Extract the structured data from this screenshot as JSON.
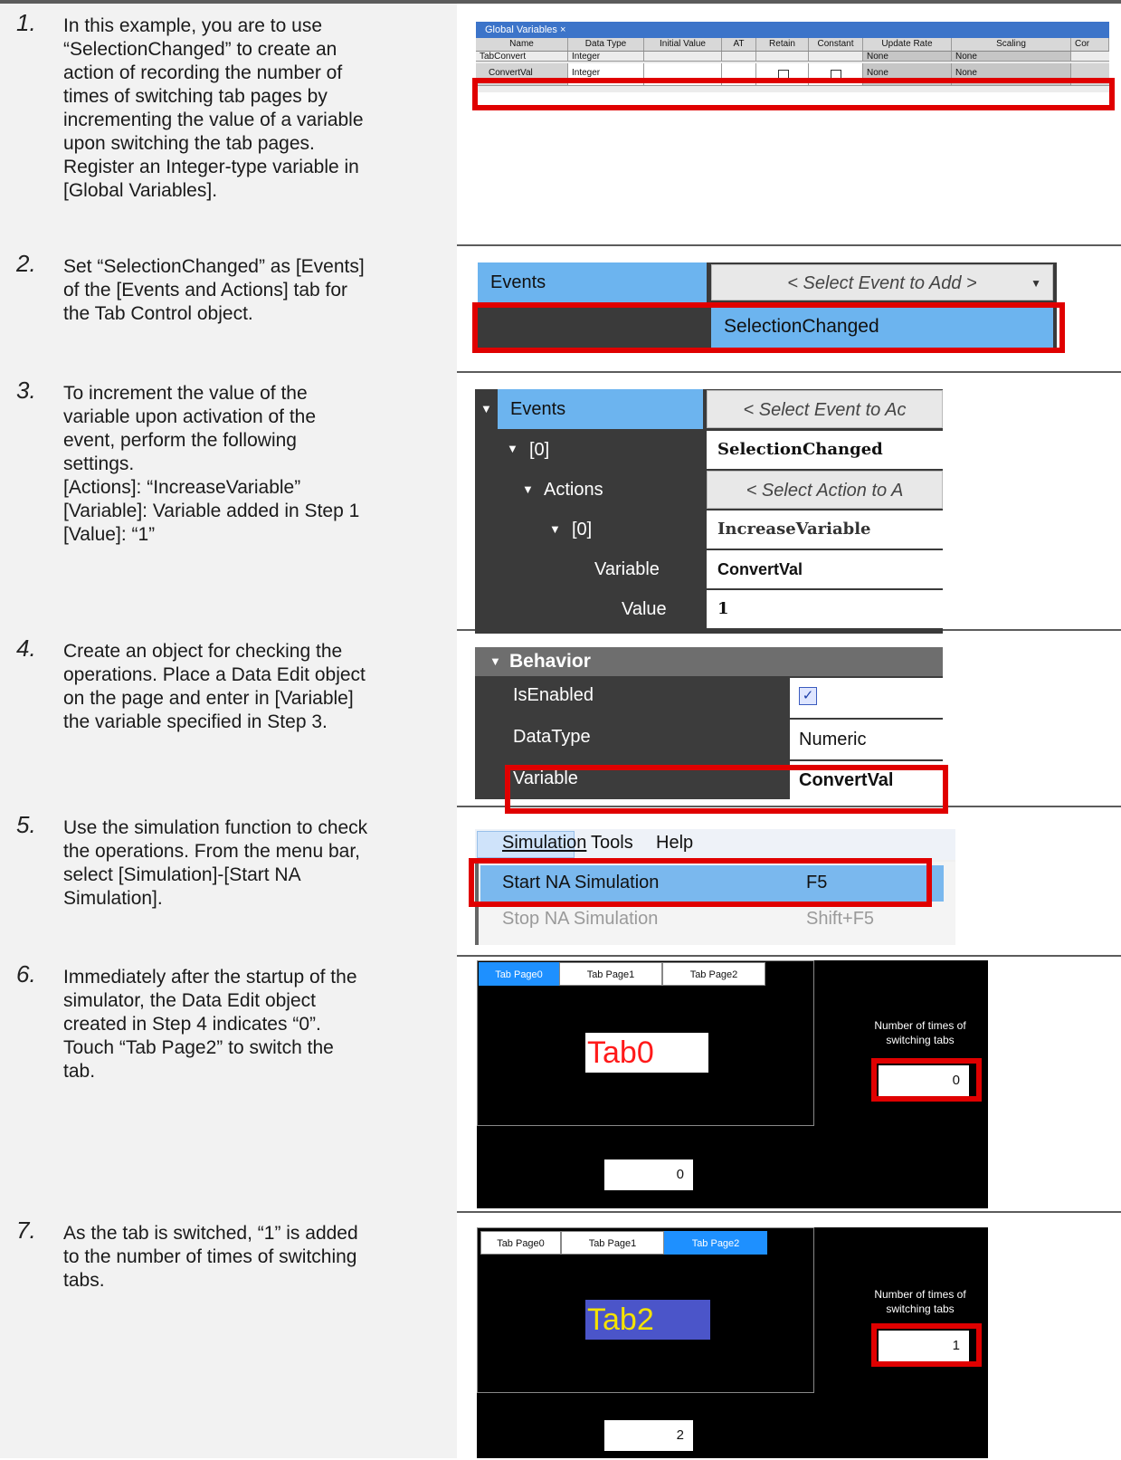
{
  "steps": [
    {
      "num": "1.",
      "lines": [
        "In this example, you are to use",
        "“SelectionChanged” to create an",
        "action of recording the number of",
        "times of switching tab pages by",
        "incrementing the value of a variable",
        "upon switching the tab pages.",
        "Register an Integer-type variable in",
        "[Global Variables]."
      ]
    },
    {
      "num": "2.",
      "lines": [
        "Set “SelectionChanged” as [Events]",
        "of the [Events and Actions] tab for",
        "the Tab Control object."
      ]
    },
    {
      "num": "3.",
      "lines": [
        "To increment the value of the",
        "variable upon activation of the",
        "event, perform the following",
        "settings.",
        "[Actions]: “IncreaseVariable”",
        "[Variable]: Variable added in Step 1",
        "[Value]: “1”"
      ]
    },
    {
      "num": "4.",
      "lines": [
        "Create an object for checking the",
        "operations. Place a Data Edit object",
        "on the page and enter in [Variable]",
        "the variable specified in Step 3."
      ]
    },
    {
      "num": "5.",
      "lines": [
        "Use the simulation function to check",
        "the operations. From the menu bar,",
        "select [Simulation]-[Start NA",
        "Simulation]."
      ]
    },
    {
      "num": "6.",
      "lines": [
        "Immediately after the startup of the",
        "simulator, the Data Edit object",
        "created in Step 4 indicates “0”.",
        "Touch “Tab Page2” to switch the",
        "tab."
      ]
    },
    {
      "num": "7.",
      "lines": [
        "As the tab is switched, “1” is added",
        "to the number of times of switching",
        "tabs."
      ]
    }
  ],
  "global_vars": {
    "tab_title": "Global Variables ×",
    "headers": [
      "Name",
      "Data Type",
      "Initial Value",
      "AT",
      "Retain",
      "Constant",
      "Update Rate",
      "Scaling",
      "Cor"
    ],
    "rows": [
      {
        "name": "TabConvert",
        "type": "Integer",
        "update": "None",
        "scaling": "None"
      },
      {
        "name": "ConvertVal",
        "type": "Integer",
        "update": "None",
        "scaling": "None"
      }
    ]
  },
  "step2": {
    "events_label": "Events",
    "select_placeholder": "< Select Event to Add >",
    "option": "SelectionChanged"
  },
  "step3": {
    "events_label": "Events",
    "events_btn": "< Select Event to Ac",
    "idx0": "[0]",
    "event_name": "SelectionChanged",
    "actions_label": "Actions",
    "actions_btn": "< Select Action to A",
    "idx1": "[0]",
    "action_name": "IncreaseVariable",
    "variable_label": "Variable",
    "variable_value": "ConvertVal",
    "value_label": "Value",
    "value_value": "1"
  },
  "step4": {
    "section": "Behavior",
    "rows": [
      {
        "label": "IsEnabled",
        "value": "☑"
      },
      {
        "label": "DataType",
        "value": "Numeric"
      },
      {
        "label": "Variable",
        "value": "ConvertVal"
      }
    ]
  },
  "step5": {
    "menu": [
      "Simulation",
      "Tools",
      "Help"
    ],
    "start": "Start NA Simulation",
    "start_key": "F5",
    "stop": "Stop NA Simulation",
    "stop_key": "Shift+F5"
  },
  "step6": {
    "tabs": [
      "Tab Page0",
      "Tab Page1",
      "Tab Page2"
    ],
    "content": "Tab0",
    "counter_label": "Number of times of switching tabs",
    "counter_value": "0",
    "bottom_value": "0"
  },
  "step7": {
    "tabs": [
      "Tab Page0",
      "Tab Page1",
      "Tab Page2"
    ],
    "content": "Tab2",
    "counter_label": "Number of times of switching tabs",
    "counter_value": "1",
    "bottom_value": "2"
  },
  "colors": {
    "highlight": "#e00000",
    "active_tab": "#1e90ff",
    "panel_blue": "#6cb4ef",
    "tab2_bg": "#4b55c9",
    "tab2_text": "#f4e200",
    "tab0_text": "#ff1a1a"
  }
}
